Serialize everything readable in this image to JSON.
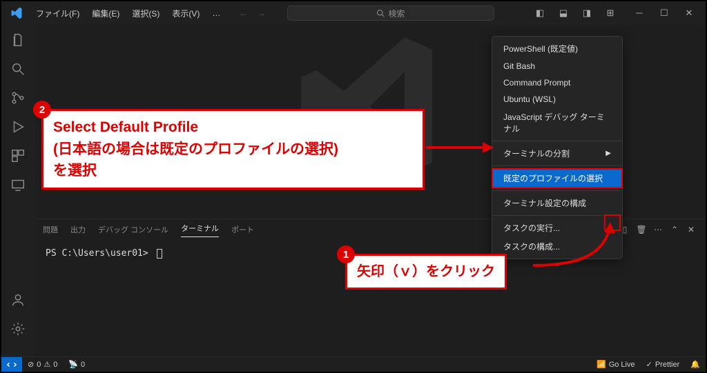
{
  "titlebar": {
    "menus": [
      "ファイル(F)",
      "編集(E)",
      "選択(S)",
      "表示(V)"
    ],
    "overflow": "…",
    "search_placeholder": "検索"
  },
  "activitybar": {
    "icons": [
      "explorer",
      "search",
      "scm",
      "debug",
      "extensions",
      "remote"
    ],
    "bottom_icons": [
      "account",
      "settings"
    ]
  },
  "panel": {
    "tabs": [
      "問題",
      "出力",
      "デバッグ コンソール",
      "ターミナル",
      "ポート"
    ],
    "active_tab": "ターミナル",
    "shell_indicator": "powershell",
    "prompt": "PS C:\\Users\\user01>"
  },
  "dropdown": {
    "items": [
      {
        "label": "PowerShell (既定値)"
      },
      {
        "label": "Git Bash"
      },
      {
        "label": "Command Prompt"
      },
      {
        "label": "Ubuntu (WSL)"
      },
      {
        "label": "JavaScript デバッグ ターミナル"
      },
      {
        "sep": true
      },
      {
        "label": "ターミナルの分割",
        "submenu": true
      },
      {
        "sep": true
      },
      {
        "label": "既定のプロファイルの選択",
        "selected": true
      },
      {
        "sep": true
      },
      {
        "label": "ターミナル設定の構成"
      },
      {
        "sep": true
      },
      {
        "label": "タスクの実行..."
      },
      {
        "label": "タスクの構成..."
      }
    ]
  },
  "statusbar": {
    "errors": "0",
    "warnings": "0",
    "ports": "0",
    "golive": "Go Live",
    "prettier": "Prettier"
  },
  "annotations": {
    "a1": "矢印（ｖ）をクリック",
    "a2_l1": "Select Default Profile",
    "a2_l2": "(日本語の場合は既定のプロファイルの選択)",
    "a2_l3": "を選択"
  }
}
